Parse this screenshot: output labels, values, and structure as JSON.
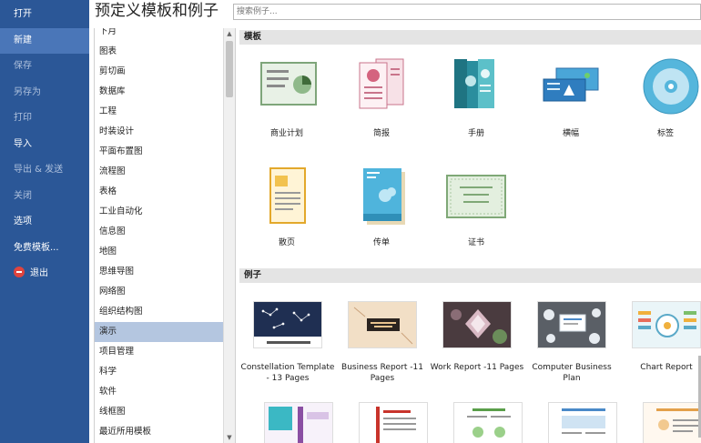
{
  "sidebar": {
    "items": [
      {
        "label": "打开"
      },
      {
        "label": "新建"
      },
      {
        "label": "保存"
      },
      {
        "label": "另存为"
      },
      {
        "label": "打印"
      },
      {
        "label": "导入"
      },
      {
        "label": "导出 & 发送"
      },
      {
        "label": "关闭"
      },
      {
        "label": "选项"
      },
      {
        "label": "免费模板..."
      },
      {
        "label": "退出"
      }
    ]
  },
  "header": {
    "title": "预定义模板和例子",
    "search_placeholder": "搜索例子..."
  },
  "categories": [
    {
      "label": "图表"
    },
    {
      "label": "剪切画"
    },
    {
      "label": "数据库"
    },
    {
      "label": "工程"
    },
    {
      "label": "时装设计"
    },
    {
      "label": "平面布置图"
    },
    {
      "label": "流程图"
    },
    {
      "label": "表格"
    },
    {
      "label": "工业自动化"
    },
    {
      "label": "信息图"
    },
    {
      "label": "地图"
    },
    {
      "label": "思维导图"
    },
    {
      "label": "网络图"
    },
    {
      "label": "组织结构图"
    },
    {
      "label": "演示"
    },
    {
      "label": "项目管理"
    },
    {
      "label": "科学"
    },
    {
      "label": "软件"
    },
    {
      "label": "线框图"
    },
    {
      "label": "最近所用模板"
    }
  ],
  "templates": {
    "heading": "模板",
    "items": [
      {
        "label": "商业计划",
        "icon": "business-plan-icon"
      },
      {
        "label": "简报",
        "icon": "newsletter-icon"
      },
      {
        "label": "手册",
        "icon": "brochure-icon"
      },
      {
        "label": "横幅",
        "icon": "banner-icon"
      },
      {
        "label": "标签",
        "icon": "cd-label-icon"
      },
      {
        "label": "散页",
        "icon": "flyer-icon"
      },
      {
        "label": "传单",
        "icon": "leaflet-icon"
      },
      {
        "label": "证书",
        "icon": "certificate-icon"
      }
    ]
  },
  "examples": {
    "heading": "例子",
    "items": [
      {
        "label": "Constellation Template - 13 Pages"
      },
      {
        "label": "Business Report -11 Pages"
      },
      {
        "label": "Work Report -11 Pages"
      },
      {
        "label": "Computer Business Plan"
      },
      {
        "label": "Chart Report"
      }
    ]
  },
  "colors": {
    "sidebar": "#2b5797",
    "sidebar_active": "#4a76b8",
    "category_selected": "#b4c6e0",
    "section_header": "#e4e4e4"
  }
}
